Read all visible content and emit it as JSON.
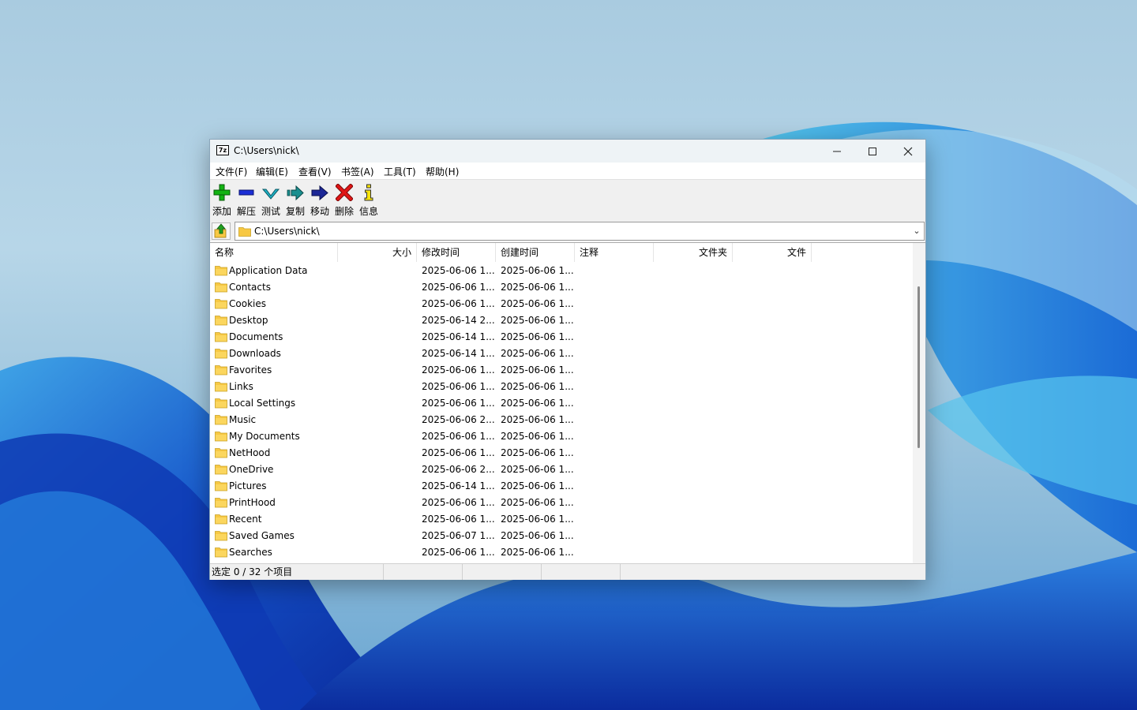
{
  "colors": {
    "window_bg": "#ffffff",
    "titlebar_bg": "#eef3f6",
    "toolbar_bg": "#f0f0f0",
    "folder_yellow": "#f7c843",
    "add_green": "#12b312",
    "extract_blue": "#1c2fd6",
    "test_cyan": "#1fb3c7",
    "copy_teal": "#1a8f8f",
    "move_navy": "#1c2796",
    "delete_red": "#e01515",
    "info_yellow": "#f5e20a"
  },
  "window": {
    "title": "C:\\Users\\nick\\",
    "app_icon_text": "7z",
    "minimize_icon": "minimize-icon",
    "maximize_icon": "maximize-icon",
    "close_icon": "close-icon"
  },
  "menu": {
    "items": [
      "文件(F)",
      "编辑(E)",
      "查看(V)",
      "书签(A)",
      "工具(T)",
      "帮助(H)"
    ]
  },
  "toolbar": {
    "buttons": [
      {
        "label": "添加",
        "icon": "add-plus-icon"
      },
      {
        "label": "解压",
        "icon": "extract-minus-icon"
      },
      {
        "label": "测试",
        "icon": "test-check-icon"
      },
      {
        "label": "复制",
        "icon": "copy-arrow-icon"
      },
      {
        "label": "移动",
        "icon": "move-arrow-icon"
      },
      {
        "label": "删除",
        "icon": "delete-x-icon"
      },
      {
        "label": "信息",
        "icon": "info-icon"
      }
    ]
  },
  "address": {
    "path": "C:\\Users\\nick\\",
    "up_icon": "up-folder-icon",
    "dropdown_icon": "chevron-down-icon"
  },
  "columns": [
    "名称",
    "大小",
    "修改时间",
    "创建时间",
    "注释",
    "文件夹",
    "文件"
  ],
  "files": [
    {
      "name": "Application Data",
      "modified": "2025-06-06 1...",
      "created": "2025-06-06 1..."
    },
    {
      "name": "Contacts",
      "modified": "2025-06-06 1...",
      "created": "2025-06-06 1..."
    },
    {
      "name": "Cookies",
      "modified": "2025-06-06 1...",
      "created": "2025-06-06 1..."
    },
    {
      "name": "Desktop",
      "modified": "2025-06-14 2...",
      "created": "2025-06-06 1..."
    },
    {
      "name": "Documents",
      "modified": "2025-06-14 1...",
      "created": "2025-06-06 1..."
    },
    {
      "name": "Downloads",
      "modified": "2025-06-14 1...",
      "created": "2025-06-06 1..."
    },
    {
      "name": "Favorites",
      "modified": "2025-06-06 1...",
      "created": "2025-06-06 1..."
    },
    {
      "name": "Links",
      "modified": "2025-06-06 1...",
      "created": "2025-06-06 1..."
    },
    {
      "name": "Local Settings",
      "modified": "2025-06-06 1...",
      "created": "2025-06-06 1..."
    },
    {
      "name": "Music",
      "modified": "2025-06-06 2...",
      "created": "2025-06-06 1..."
    },
    {
      "name": "My Documents",
      "modified": "2025-06-06 1...",
      "created": "2025-06-06 1..."
    },
    {
      "name": "NetHood",
      "modified": "2025-06-06 1...",
      "created": "2025-06-06 1..."
    },
    {
      "name": "OneDrive",
      "modified": "2025-06-06 2...",
      "created": "2025-06-06 1..."
    },
    {
      "name": "Pictures",
      "modified": "2025-06-14 1...",
      "created": "2025-06-06 1..."
    },
    {
      "name": "PrintHood",
      "modified": "2025-06-06 1...",
      "created": "2025-06-06 1..."
    },
    {
      "name": "Recent",
      "modified": "2025-06-06 1...",
      "created": "2025-06-06 1..."
    },
    {
      "name": "Saved Games",
      "modified": "2025-06-07 1...",
      "created": "2025-06-06 1..."
    },
    {
      "name": "Searches",
      "modified": "2025-06-06 1...",
      "created": "2025-06-06 1..."
    }
  ],
  "status": {
    "selection": "选定 0 / 32 个项目"
  }
}
